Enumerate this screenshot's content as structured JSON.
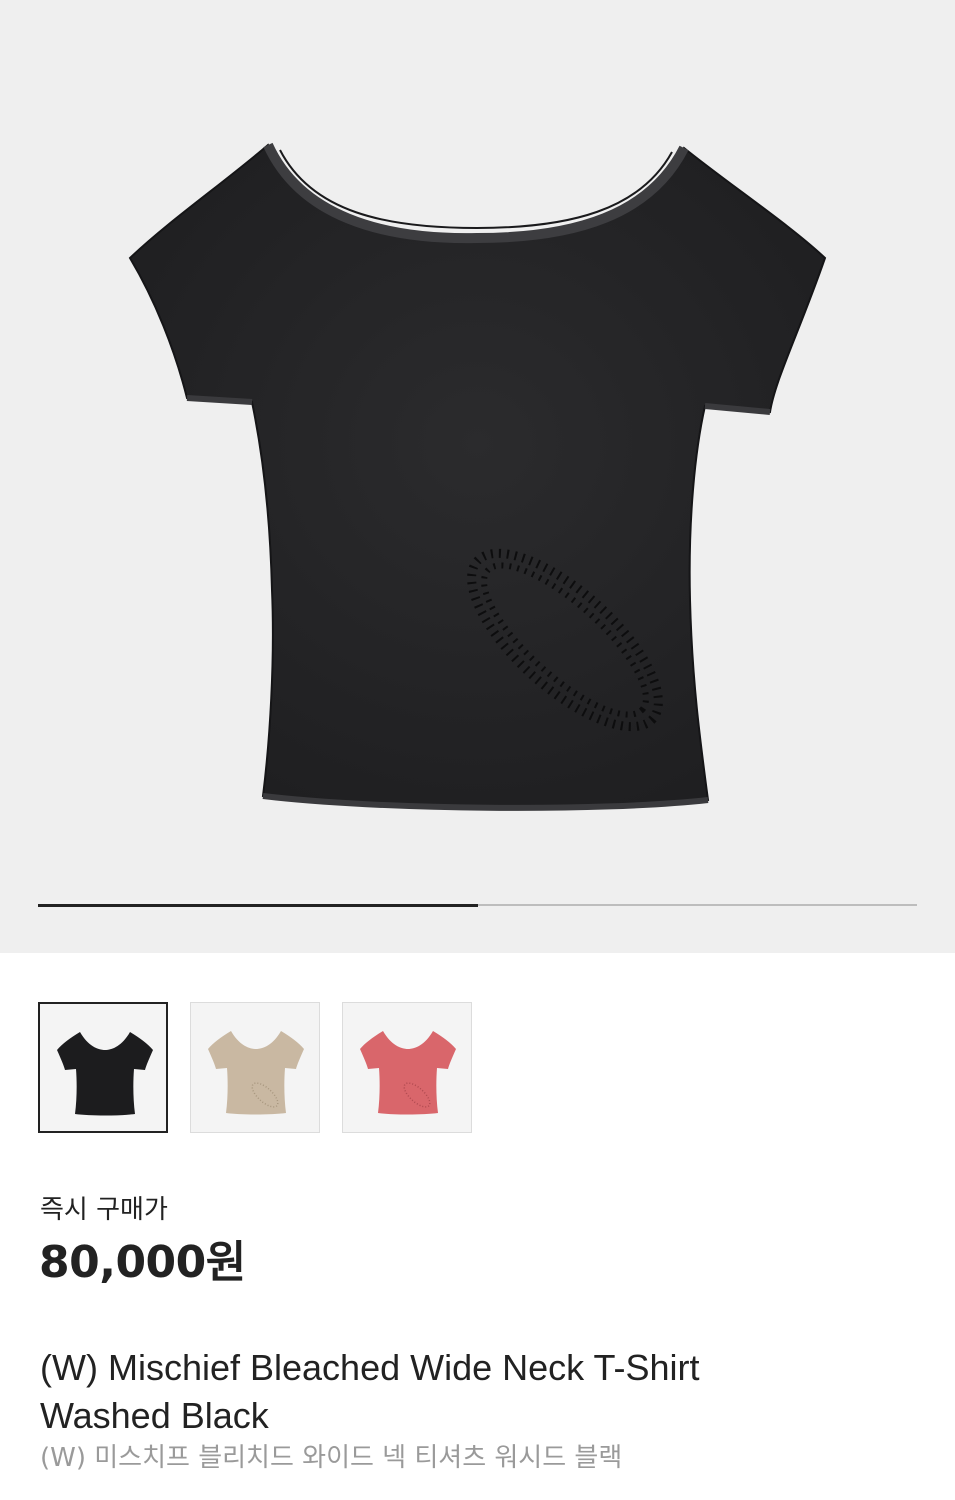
{
  "gallery": {
    "main_image_alt": "black wide neck t-shirt",
    "progress_fraction": 0.5,
    "thumbnails": [
      {
        "name": "black",
        "color": "#1c1c1e",
        "selected": true
      },
      {
        "name": "beige",
        "color": "#c9b8a2",
        "selected": false
      },
      {
        "name": "pink",
        "color": "#d9666b",
        "selected": false
      }
    ]
  },
  "purchase": {
    "label": "즉시 구매가",
    "price": "80,000원"
  },
  "product": {
    "title_line1": "(W) Mischief Bleached Wide Neck T-Shirt",
    "title_line2": "Washed Black",
    "subtitle": "(W) 미스치프 블리치드 와이드 넥 티셔츠 워시드 블랙"
  },
  "colors": {
    "hero_bg": "#efefef",
    "shirt_black": "#2a2a2c",
    "progress_active": "#222222",
    "progress_track": "#bdbdbd"
  }
}
